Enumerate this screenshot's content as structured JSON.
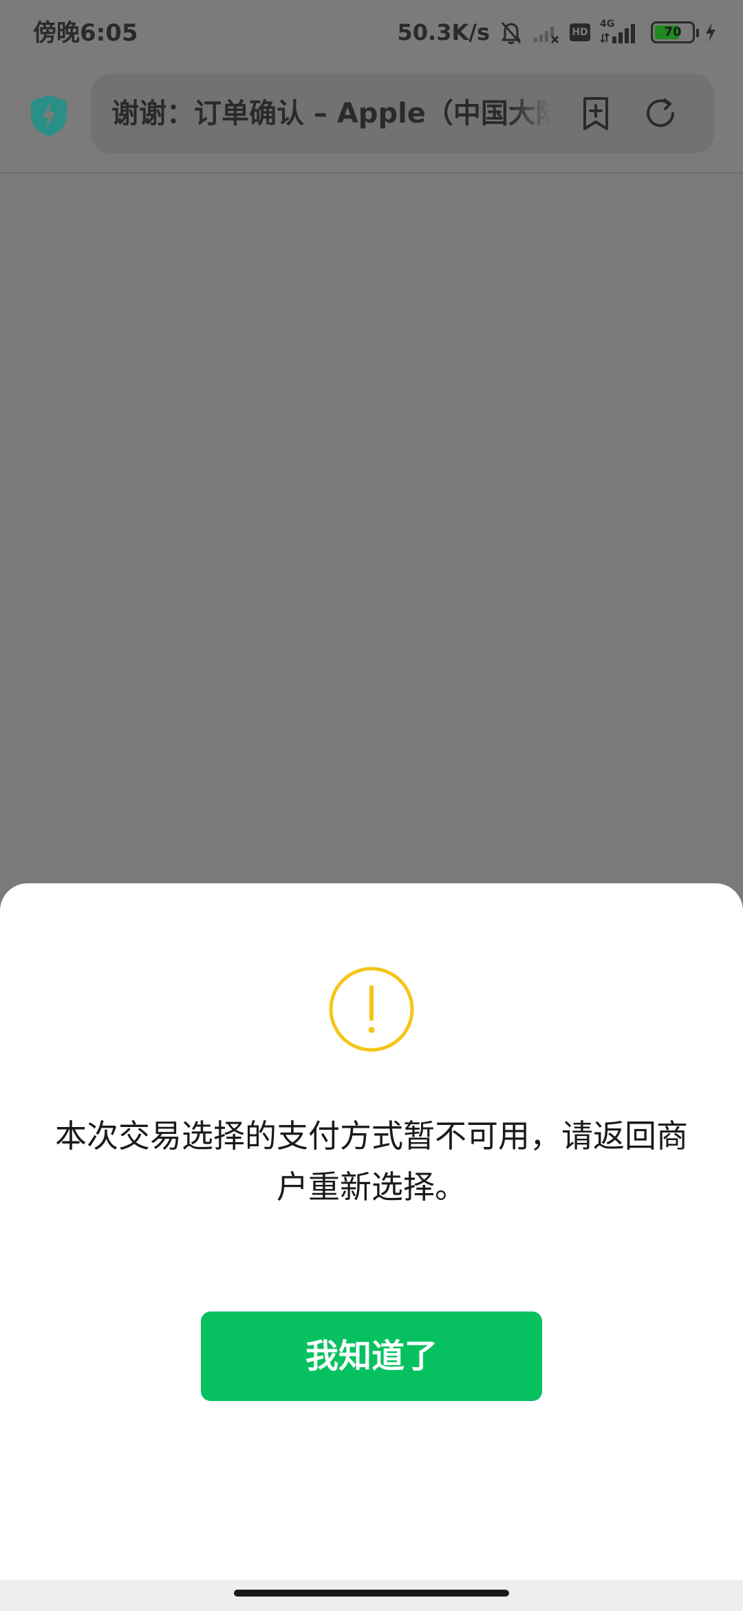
{
  "status_bar": {
    "time": "傍晚6:05",
    "net_speed": "50.3K/s",
    "hd_label": "HD",
    "network_type": "4G",
    "battery_percent": "70",
    "battery_level": 0.7,
    "icons": [
      "bell-muted-icon",
      "signal-empty-icon",
      "hd-icon",
      "signal-4g-icon",
      "battery-icon",
      "charging-icon"
    ]
  },
  "browser": {
    "page_title": "谢谢：订单确认 – Apple（中国大陆",
    "icons": [
      "shield-icon",
      "bookmark-add-icon",
      "refresh-icon"
    ]
  },
  "dialog": {
    "icon": "warning-icon",
    "message": "本次交易选择的支付方式暂不可用，请返回商户重新选择。",
    "confirm_label": "我知道了"
  },
  "colors": {
    "accent_green": "#07c160",
    "warning_yellow": "#f5c518",
    "shield_teal": "#2aa198"
  }
}
